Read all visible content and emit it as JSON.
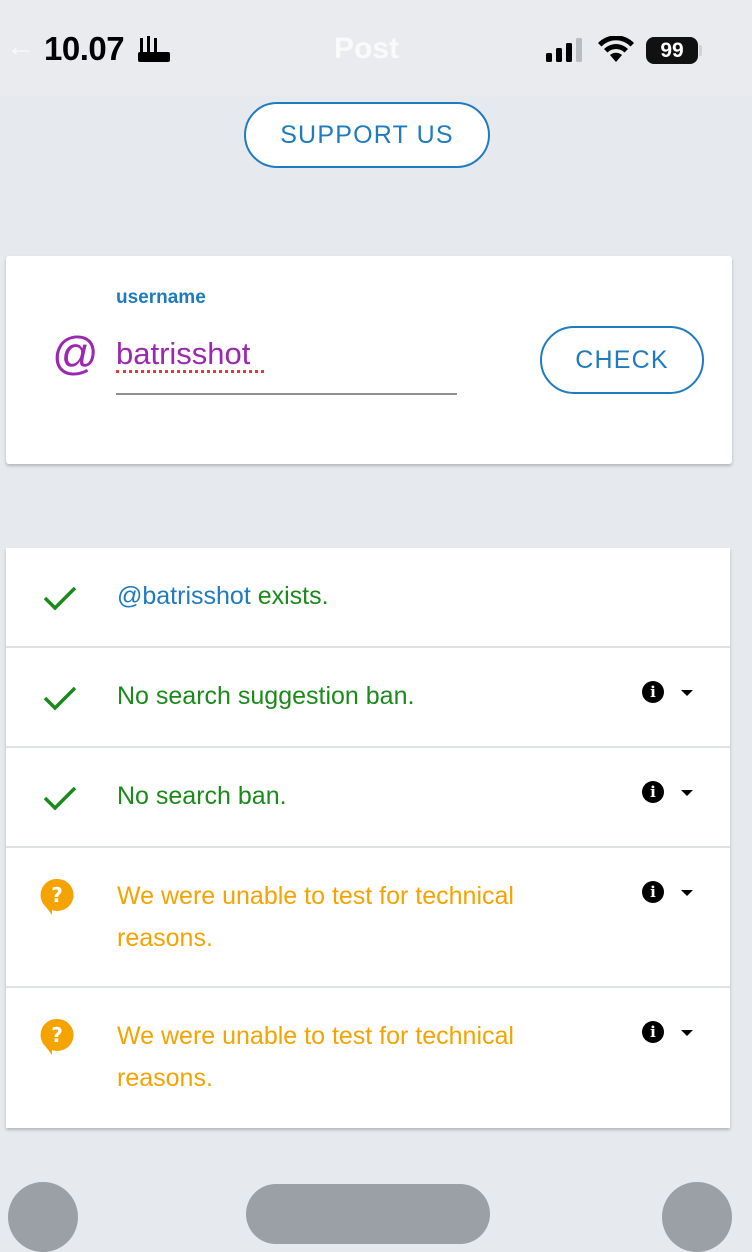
{
  "status_bar": {
    "time": "10.07",
    "battery": "99",
    "header_back": "←",
    "header_title": "Post"
  },
  "support_button": "SUPPORT US",
  "search": {
    "label": "username",
    "at_symbol": "@",
    "value": "batrisshot",
    "check_button": "CHECK"
  },
  "results": [
    {
      "handle": "@batrisshot",
      "text": " exists.",
      "status": "ok",
      "has_info": false
    },
    {
      "text": "No search suggestion ban.",
      "status": "ok",
      "has_info": true
    },
    {
      "text": "No search ban.",
      "status": "ok",
      "has_info": true
    },
    {
      "text_line1": "We were unable to test for technical",
      "text_line2": "reasons.",
      "status": "unknown",
      "has_info": true
    },
    {
      "text_line1": "We were unable to test for technical",
      "text_line2": "reasons.",
      "status": "unknown",
      "has_info": true
    }
  ],
  "info_glyph": "i",
  "colors": {
    "accent": "#1f7bbf",
    "username": "#9c27b0",
    "success": "#1b8a1b",
    "warning": "#f4a300"
  }
}
